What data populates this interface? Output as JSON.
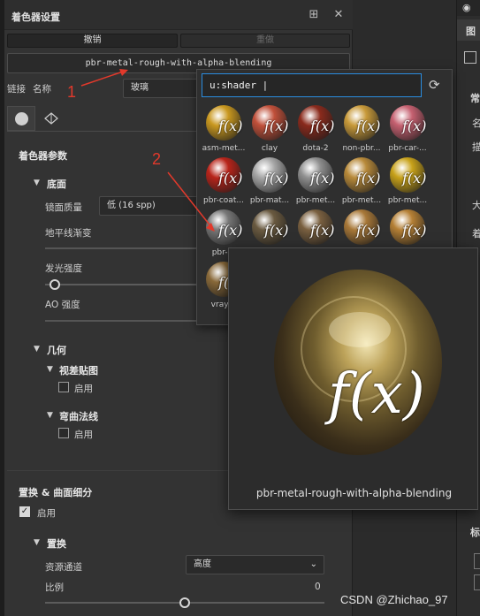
{
  "panel": {
    "title": "着色器设置",
    "undo_label": "撤销",
    "redo_label": "重做",
    "shader_name": "pbr-metal-rough-with-alpha-blending",
    "link_label": "链接",
    "name_label": "名称",
    "name_value": "玻璃",
    "section_shader_params": "着色器参数",
    "base_label": "底面",
    "mirror_quality_label": "镜面质量",
    "mirror_quality_value": "低 (16 spp)",
    "horizon_fade_label": "地平线渐变",
    "emissive_label": "发光强度",
    "ao_label": "AO 强度",
    "geometry_label": "几何",
    "parallax_label": "视差贴图",
    "enable_label": "启用",
    "bent_normal_label": "弯曲法线",
    "displacement_section_label": "置换 & 曲面细分",
    "displacement_label": "置换",
    "resource_channel_label": "资源通道",
    "resource_channel_value": "高度",
    "scale_label": "比例",
    "scale_value": "0"
  },
  "search": {
    "query": "u:shader |"
  },
  "shaders": [
    {
      "name": "asm-met...",
      "color": "#c9981f"
    },
    {
      "name": "clay",
      "color": "#c0503a"
    },
    {
      "name": "dota-2",
      "color": "#8a2a1c"
    },
    {
      "name": "non-pbr...",
      "color": "#c89a3a"
    },
    {
      "name": "pbr-car-...",
      "color": "#c56070"
    },
    {
      "name": "pbr-coat...",
      "color": "#b8241a"
    },
    {
      "name": "pbr-mat...",
      "color": "#a8a8a8"
    },
    {
      "name": "pbr-met...",
      "color": "#909090"
    },
    {
      "name": "pbr-met...",
      "color": "#b88a3a"
    },
    {
      "name": "pbr-met...",
      "color": "#c8a21a"
    },
    {
      "name": "pbr-m",
      "color": "#777777"
    },
    {
      "name": "",
      "color": "#6a5a40"
    },
    {
      "name": "",
      "color": "#7a6040"
    },
    {
      "name": "",
      "color": "#a87838"
    },
    {
      "name": "",
      "color": "#b58035"
    },
    {
      "name": "vraym",
      "color": "#8a6a3a"
    }
  ],
  "preview": {
    "name": "pbr-metal-rough-with-alpha-blending",
    "fx": "f(x)"
  },
  "annotations": {
    "one": "1",
    "two": "2"
  },
  "right_panel": {
    "tab_label": "图",
    "chars": [
      "常",
      "名",
      "描",
      "大",
      "着",
      "标"
    ]
  },
  "watermark": "CSDN @Zhichao_97"
}
